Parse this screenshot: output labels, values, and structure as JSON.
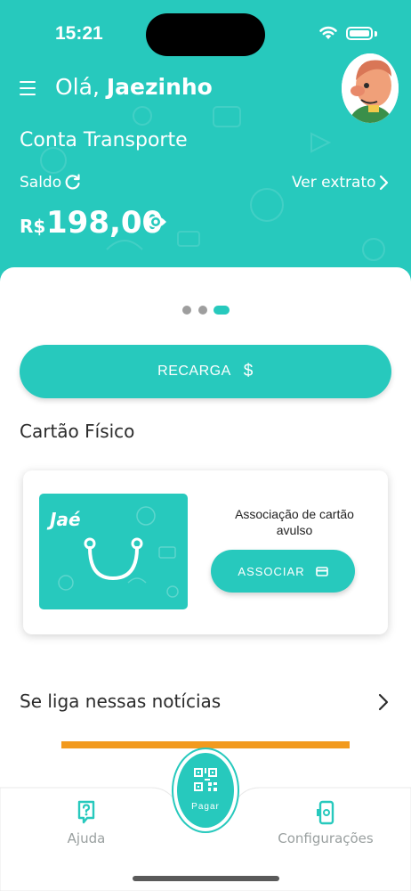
{
  "status_bar": {
    "time": "15:21"
  },
  "header": {
    "greeting_prefix": "Olá,",
    "user_name": "Jaezinho",
    "account_title": "Conta Transporte",
    "balance_label": "Saldo",
    "statement_link": "Ver extrato",
    "currency": "R$",
    "balance": "198,00"
  },
  "carousel": {
    "pages": 3,
    "active_page": 3
  },
  "recharge": {
    "label": "RECARGA",
    "symbol": "$"
  },
  "physical_card": {
    "section_title": "Cartão Físico",
    "card_brand": "Jaé",
    "association_text": "Associação de cartão avulso",
    "associate_button": "ASSOCIAR"
  },
  "news": {
    "section_title": "Se liga nessas notícias"
  },
  "tabbar": {
    "help_label": "Ajuda",
    "pay_label": "Pagar",
    "settings_label": "Configurações"
  },
  "colors": {
    "brand": "#27c9bd",
    "banner": "#f29a1e"
  },
  "icons": [
    "menu-icon",
    "refresh-icon",
    "chevron-right-icon",
    "eye-icon",
    "card-icon",
    "help-icon",
    "qr-code-icon",
    "phone-settings-icon",
    "wifi-icon",
    "battery-icon"
  ]
}
